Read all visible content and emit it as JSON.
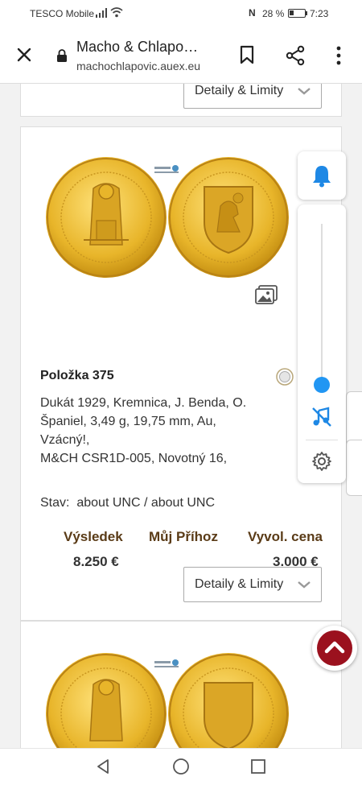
{
  "status_bar": {
    "carrier": "TESCO Mobile",
    "nfc": "N",
    "battery": "28 %",
    "time": "7:23"
  },
  "browser": {
    "title": "Macho & Chlapo…",
    "url": "machochlapovic.auex.eu"
  },
  "top_card": {
    "detail_button": "Detaily & Limity"
  },
  "lot": {
    "title": "Položka 375",
    "description_lines": [
      "Dukát 1929, Kremnica, J. Benda, O.",
      "Španiel, 3,49 g, 19,75 mm, Au,",
      "Vzácný!,",
      "M&CH CSR1D-005, Novotný 16,"
    ],
    "state_label": "Stav:",
    "state_value": "about UNC / about UNC",
    "columns": {
      "result_label": "Výsledek",
      "my_bid_label": "Můj Příhoz",
      "start_price_label": "Vyvol. cena"
    },
    "result_value": "8.250 €",
    "start_price_value": "3.000 €",
    "detail_button": "Detaily & Limity"
  },
  "side_panel": {
    "slider_level_percent": 0
  },
  "colors": {
    "accent_blue": "#2196f3",
    "label_brown": "#5a3b17",
    "scroll_top_red": "#9b111e",
    "gold": "#e8b52a"
  }
}
